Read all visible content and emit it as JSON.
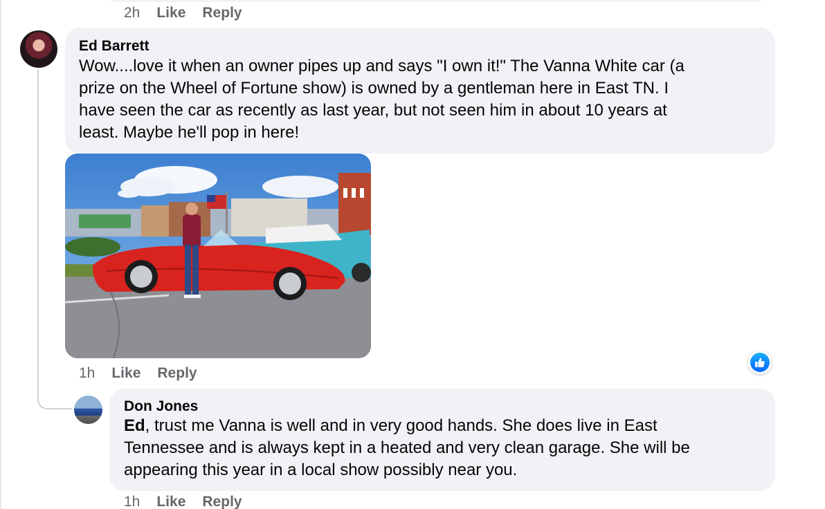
{
  "top_comment_actions": {
    "time": "2h",
    "like": "Like",
    "reply": "Reply"
  },
  "comments": [
    {
      "author": "Ed Barrett",
      "lines": [
        "Wow....love it when an owner pipes up and says \"I own it!\" The Vanna White car (a",
        "prize on the Wheel of Fortune show) is owned by a gentleman here in East TN. I",
        "have seen the car as recently as last year, but not seen him in about 10 years at",
        "least. Maybe he'll pop in here!"
      ],
      "actions": {
        "time": "1h",
        "like": "Like",
        "reply": "Reply"
      },
      "reaction_icon": "like-icon"
    },
    {
      "author": "Don Jones",
      "mention": "Ed",
      "line1_rest": ", trust me Vanna is well and in very good hands. She does live in East",
      "lines": [
        "Tennessee and is always kept in a heated and very clean garage. She will be",
        "appearing this year in a local show possibly near you."
      ],
      "actions": {
        "time": "1h",
        "like": "Like",
        "reply": "Reply"
      }
    }
  ],
  "colors": {
    "bubble": "#f0f2f5",
    "meta_text": "#65676b",
    "like_blue": "#0866ff",
    "car_red": "#d8231f"
  }
}
